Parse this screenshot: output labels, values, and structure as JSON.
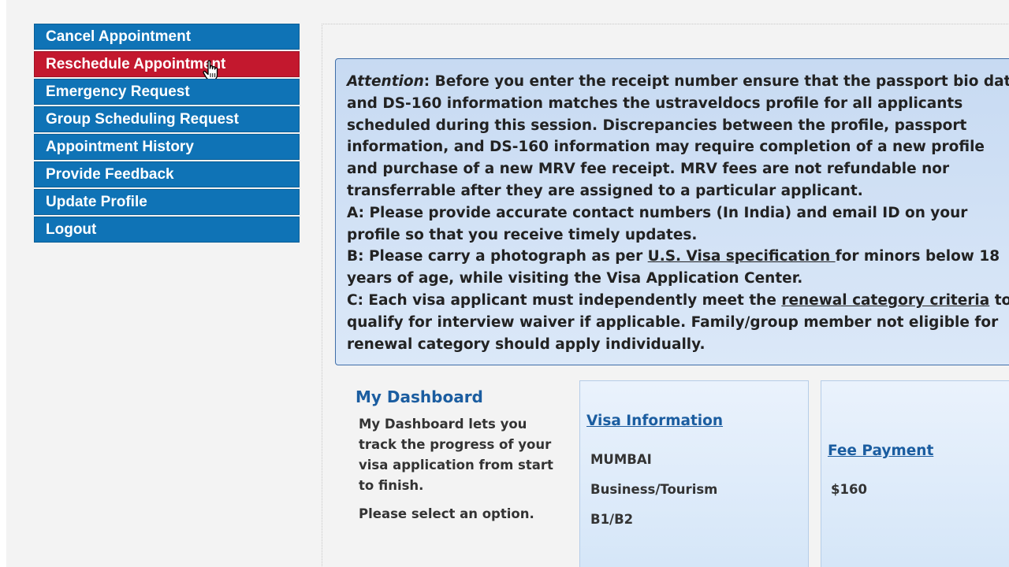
{
  "sidebar": {
    "items": [
      {
        "label": "Cancel Appointment"
      },
      {
        "label": "Reschedule Appointment"
      },
      {
        "label": "Emergency Request"
      },
      {
        "label": "Group Scheduling Request"
      },
      {
        "label": "Appointment History"
      },
      {
        "label": "Provide Feedback"
      },
      {
        "label": "Update Profile"
      },
      {
        "label": "Logout"
      }
    ],
    "active_index": 1
  },
  "attention": {
    "heading": "Attention",
    "l1": ": Before you enter the receipt number ensure that the passport bio data",
    "l2": "and DS-160 information matches the ustraveldocs profile for all applicants",
    "l3": "scheduled during this session. Discrepancies between the profile, passport",
    "l4": "information, and DS-160 information may require completion of a new profile",
    "l5": "and purchase of a new MRV fee receipt. MRV fees are not refundable nor",
    "l6": "transferrable after they are assigned to a particular applicant.",
    "l7": "A: Please provide accurate contact numbers (In India) and email ID on your",
    "l8": "profile so that you receive timely updates.",
    "l9a": "B: Please carry a photograph as per ",
    "l9_link": "U.S. Visa specification ",
    "l9b": "for minors below 18",
    "l10": "years of age, while visiting the Visa Application Center.",
    "l11a": "C: Each visa applicant must independently meet the ",
    "l11_link": "renewal category criteria",
    "l11b": " to",
    "l12": "qualify for interview waiver if applicable. Family/group member not eligible for",
    "l13": "renewal category should apply individually."
  },
  "dashboard": {
    "title": "My Dashboard",
    "description": "My Dashboard lets you track the progress of your visa application from start to finish.",
    "prompt": "Please select an option."
  },
  "visa_card": {
    "title": "Visa Information",
    "location": "MUMBAI",
    "category": "Business/Tourism",
    "visa_type": "B1/B2"
  },
  "fee_card": {
    "title": "Fee Payment",
    "amount": "$160"
  },
  "colors": {
    "nav_blue": "#0f73b6",
    "nav_active_red": "#c3182e",
    "link_blue": "#1b5da0"
  }
}
